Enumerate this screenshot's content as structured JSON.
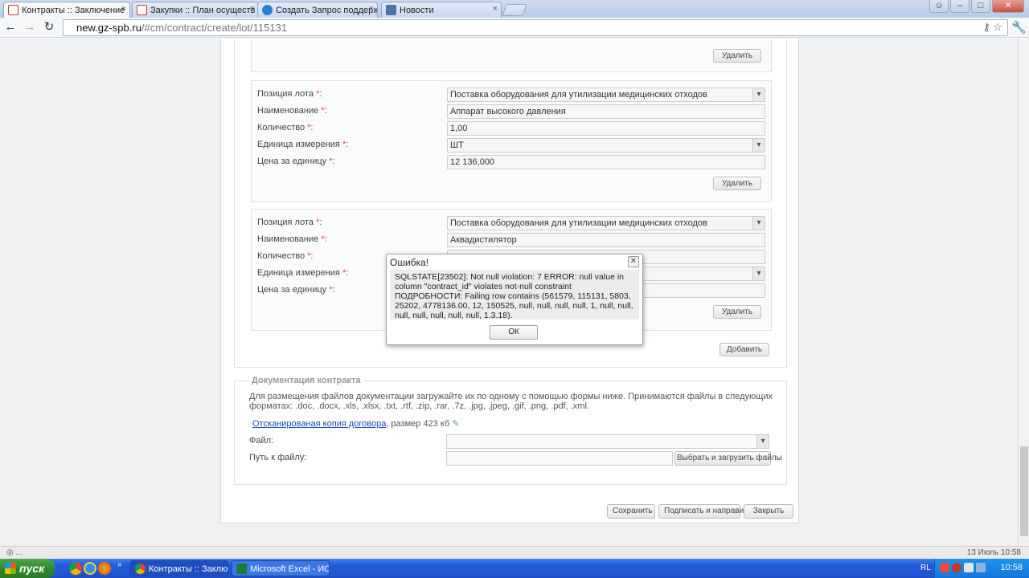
{
  "browser": {
    "tabs": [
      {
        "label": "Контракты :: Заключение",
        "color": "#c0392b"
      },
      {
        "label": "Закупки :: План осуществ",
        "color": "#c0392b"
      },
      {
        "label": "Создать Запрос поддержк",
        "color": "#2f7fd0"
      },
      {
        "label": "Новости",
        "color": "#4a76a8"
      }
    ],
    "url_host": "new.gz-spb.ru",
    "url_path": "/#cm/contract/create/lot/115131"
  },
  "form": {
    "delete_label": "Удалить",
    "add_label": "Добавить",
    "labels": {
      "position": "Позиция лота",
      "name": "Наименование",
      "quantity": "Количество",
      "unit": "Единица измерения",
      "price": "Цена за единицу",
      "required_mark": "*",
      "colon": ":"
    },
    "lots": [
      {
        "position": "Поставка оборудования для утилизации медицинских отходов",
        "name": "Аппарат высокого давления",
        "quantity": "1,00",
        "unit": "ШТ",
        "price": "12 136,000"
      },
      {
        "position": "Поставка оборудования для утилизации медицинских отходов",
        "name": "Аквадистилятор",
        "quantity": "",
        "unit": "",
        "price": ""
      }
    ]
  },
  "documents": {
    "legend": "Документация контракта",
    "description": "Для размещения файлов документации загружайте их по одному с помощью формы ниже. Принимаются файлы в следующих форматах: .doc, .docx, .xls, .xlsx, .txt, .rtf, .zip, .rar, .7z, .jpg, .jpeg, .gif, .png, .pdf, .xml.",
    "file_link": "Отсканированая копия договора",
    "file_size": ", размер 423 кб",
    "file_label": "Файл:",
    "path_label": "Путь к файлу:",
    "upload_button": "Выбрать и загрузить файлы"
  },
  "footer_buttons": {
    "save": "Сохранить",
    "sign": "Подписать и направить",
    "close": "Закрыть"
  },
  "modal": {
    "title": "Ошибка!",
    "message": "SQLSTATE[23502]: Not null violation: 7 ERROR: null value in column \"contract_id\" violates not-null constraint ПОДРОБНОСТИ: Failing row contains (561579, 115131, 5803, 25202, 4778136.00, 12, 150525, null, null, null, null, 1, null, null, null, null, null, null, null, 1.3.18).",
    "ok_label": "ОК",
    "close_glyph": "✕"
  },
  "status": {
    "left": "◎ ...",
    "right": "13 Июль 10:58"
  },
  "taskbar": {
    "start_label": "пуск",
    "tasks": [
      {
        "label": "Контракты :: Заклю...",
        "color": "#c0392b"
      },
      {
        "label": "Microsoft Excel - ИСТ...",
        "color": "#1f7a3a"
      }
    ],
    "lang": "RL",
    "clock": "10:58"
  }
}
